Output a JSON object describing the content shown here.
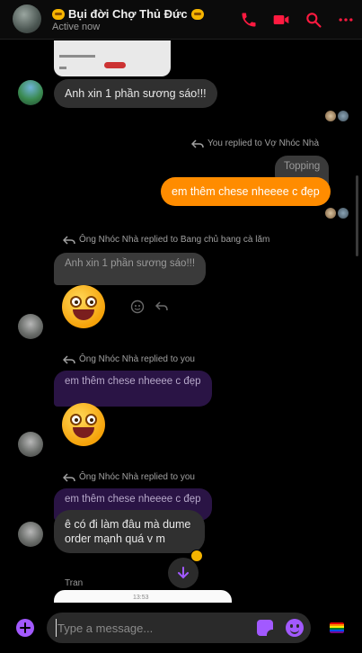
{
  "header": {
    "title": "Bụi đời Chợ Thủ Đức",
    "status": "Active now",
    "actions": [
      "phone-icon",
      "video-camera-icon",
      "search-icon",
      "more-options-icon"
    ],
    "accent_color": "#ff1a40"
  },
  "messages": {
    "m1": {
      "text": "Anh xin 1 phần sương sáo!!!"
    },
    "m2": {
      "reply_label": "You replied to Vợ Nhóc Nhà",
      "quoted": "Topping",
      "text": "em thêm chese nheeee c đẹp"
    },
    "m3": {
      "reply_label": "Ông Nhóc Nhà replied to Bang chủ bang cà lăm",
      "quoted": "Anh xin 1 phần sương sáo!!!"
    },
    "m4": {
      "reply_label": "Ông Nhóc Nhà replied to you",
      "quoted": "em thêm chese nheeee c đẹp"
    },
    "m5": {
      "reply_label": "Ông Nhóc Nhà replied to you",
      "quoted": "em thêm chese nheeee c đẹp",
      "text_line1": "ê có đi làm đâu mà dume",
      "text_line2": "order mạnh quá v m"
    },
    "m6": {
      "sender": "Tran",
      "time": "13:53"
    }
  },
  "composer": {
    "placeholder": "Type a message..."
  },
  "colors": {
    "outgoing_bubble": "#ff8c00",
    "incoming_bubble": "#303030",
    "composer_icons": "#a259ff"
  }
}
